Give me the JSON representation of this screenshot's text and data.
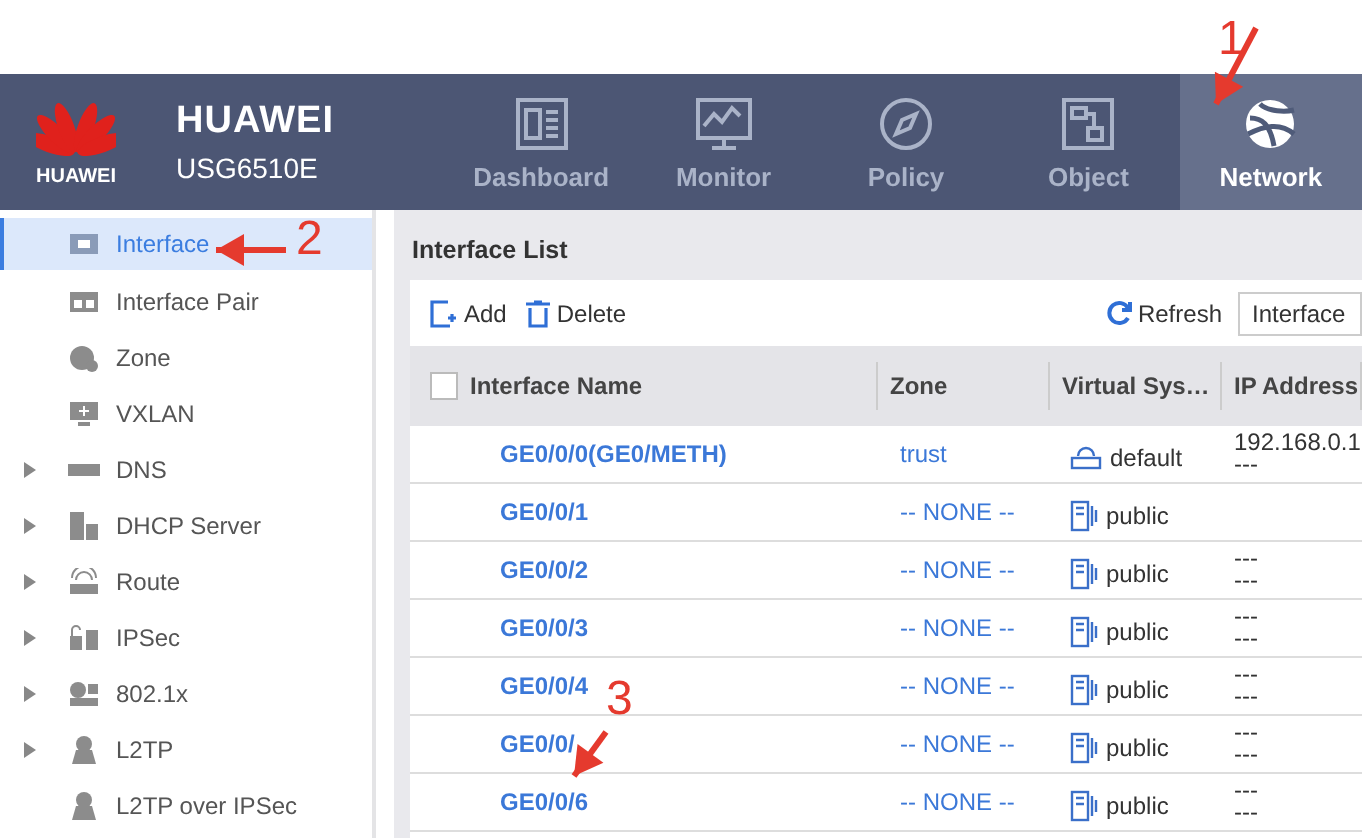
{
  "header": {
    "logo_text": "HUAWEI",
    "brand": "HUAWEI",
    "model": "USG6510E",
    "tabs": [
      {
        "label": "Dashboard",
        "selected": false
      },
      {
        "label": "Monitor",
        "selected": false
      },
      {
        "label": "Policy",
        "selected": false
      },
      {
        "label": "Object",
        "selected": false
      },
      {
        "label": "Network",
        "selected": true
      }
    ]
  },
  "sidebar": {
    "items": [
      {
        "label": "Interface",
        "expandable": false,
        "selected": true
      },
      {
        "label": "Interface Pair",
        "expandable": false,
        "selected": false
      },
      {
        "label": "Zone",
        "expandable": false,
        "selected": false
      },
      {
        "label": "VXLAN",
        "expandable": false,
        "selected": false
      },
      {
        "label": "DNS",
        "expandable": true,
        "selected": false
      },
      {
        "label": "DHCP Server",
        "expandable": true,
        "selected": false
      },
      {
        "label": "Route",
        "expandable": true,
        "selected": false
      },
      {
        "label": "IPSec",
        "expandable": true,
        "selected": false
      },
      {
        "label": "802.1x",
        "expandable": true,
        "selected": false
      },
      {
        "label": "L2TP",
        "expandable": true,
        "selected": false
      },
      {
        "label": "L2TP over IPSec",
        "expandable": false,
        "selected": false
      }
    ]
  },
  "main": {
    "title": "Interface List",
    "toolbar": {
      "add": "Add",
      "delete": "Delete",
      "refresh": "Refresh",
      "filter_value": "Interface"
    },
    "table": {
      "select_all_checked": false,
      "columns": [
        "Interface Name",
        "Zone",
        "Virtual Sys…",
        "IP Address"
      ],
      "rows": [
        {
          "name": "GE0/0/0(GE0/METH)",
          "zone": "trust",
          "vsys": "default",
          "ip": [
            "192.168.0.1",
            "---"
          ]
        },
        {
          "name": "GE0/0/1",
          "zone": "-- NONE --",
          "vsys": "public",
          "ip": []
        },
        {
          "name": "GE0/0/2",
          "zone": "-- NONE --",
          "vsys": "public",
          "ip": [
            "---",
            "---"
          ]
        },
        {
          "name": "GE0/0/3",
          "zone": "-- NONE --",
          "vsys": "public",
          "ip": [
            "---",
            "---"
          ]
        },
        {
          "name": "GE0/0/4",
          "zone": "-- NONE --",
          "vsys": "public",
          "ip": [
            "---",
            "---"
          ]
        },
        {
          "name": "GE0/0/",
          "zone": "-- NONE --",
          "vsys": "public",
          "ip": [
            "---",
            "---"
          ]
        },
        {
          "name": "GE0/0/6",
          "zone": "-- NONE --",
          "vsys": "public",
          "ip": [
            "---",
            "---"
          ]
        }
      ]
    }
  },
  "annotations": [
    {
      "label": "1"
    },
    {
      "label": "2"
    },
    {
      "label": "3"
    }
  ]
}
